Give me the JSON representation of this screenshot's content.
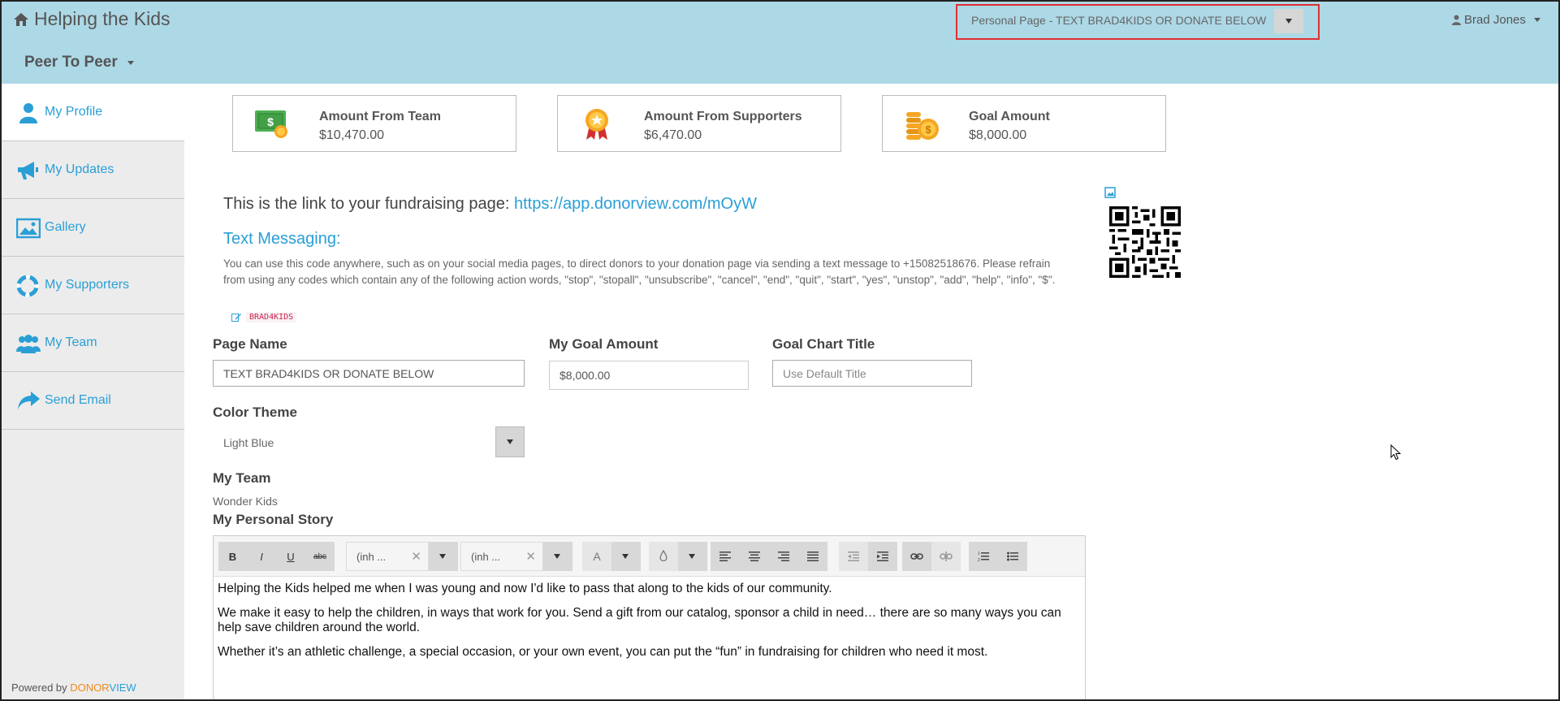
{
  "header": {
    "brand": "Helping the Kids",
    "module_menu": "Peer To Peer",
    "page_selector": "Personal Page - TEXT BRAD4KIDS OR DONATE BELOW",
    "user": "Brad Jones"
  },
  "sidebar": {
    "items": [
      {
        "label": "My Profile",
        "icon": "user-icon"
      },
      {
        "label": "My Updates",
        "icon": "megaphone-icon"
      },
      {
        "label": "Gallery",
        "icon": "image-icon"
      },
      {
        "label": "My Supporters",
        "icon": "lifebuoy-icon"
      },
      {
        "label": "My Team",
        "icon": "users-icon"
      },
      {
        "label": "Send Email",
        "icon": "share-icon"
      }
    ],
    "powered_by": "Powered by",
    "powered_brand_1": "DONOR",
    "powered_brand_2": "VIEW"
  },
  "stats": [
    {
      "title": "Amount From Team",
      "value": "$10,470.00",
      "icon": "cash-icon"
    },
    {
      "title": "Amount From Supporters",
      "value": "$6,470.00",
      "icon": "award-ribbon-icon"
    },
    {
      "title": "Goal Amount",
      "value": "$8,000.00",
      "icon": "coins-icon"
    }
  ],
  "main": {
    "link_prefix": "This is the link to your fundraising page: ",
    "link_url": "https://app.donorview.com/mOyW",
    "text_messaging_title": "Text Messaging:",
    "text_messaging_desc": "You can use this code anywhere, such as on your social media pages, to direct donors to your donation page via sending a text message to +15082518676. Please refrain from using any codes which contain any of the following action words, \"stop\", \"stopall\", \"unsubscribe\", \"cancel\", \"end\", \"quit\", \"start\", \"yes\", \"unstop\", \"add\", \"help\", \"info\", \"$\".",
    "text_code": "BRAD4KIDS"
  },
  "form": {
    "page_name_label": "Page Name",
    "page_name_value": "TEXT BRAD4KIDS OR DONATE BELOW",
    "goal_amount_label": "My Goal Amount",
    "goal_amount_value": "$8,000.00",
    "goal_chart_title_label": "Goal Chart Title",
    "goal_chart_title_placeholder": "Use Default Title",
    "color_theme_label": "Color Theme",
    "color_theme_value": "Light Blue",
    "my_team_label": "My Team",
    "my_team_value": "Wonder Kids",
    "story_label": "My Personal Story"
  },
  "editor": {
    "bold": "B",
    "italic": "I",
    "underline": "U",
    "strike": "abc",
    "font_family": "(inh ...",
    "font_size": "(inh ...",
    "font_color": "A",
    "paragraphs": [
      "Helping the Kids helped me when I was young and now I'd like to pass that along to the kids of our community.",
      "We make it easy to help the children, in ways that work for you. Send a gift from our catalog, sponsor a child in need… there are so many ways you can help save children around the world.",
      "Whether it’s an athletic challenge, a special occasion, or your own event, you can put the “fun” in fundraising for children who need it most."
    ]
  }
}
